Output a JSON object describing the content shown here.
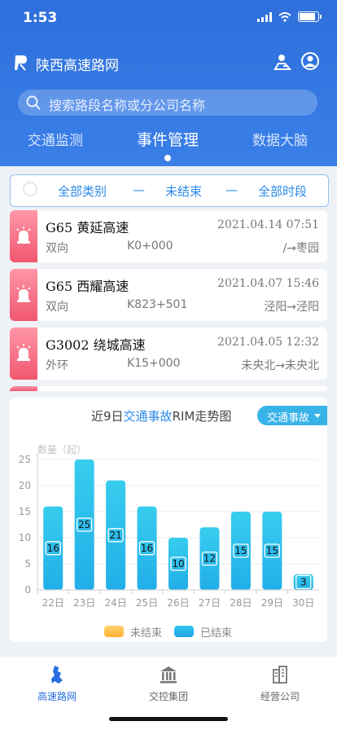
{
  "status_bar": {
    "time": "1:53"
  },
  "app": {
    "title": "陕西高速路网"
  },
  "search": {
    "placeholder": "搜索路段名称或分公司名称"
  },
  "tabs": [
    {
      "label": "交通监测",
      "active": false
    },
    {
      "label": "事件管理",
      "active": true
    },
    {
      "label": "数据大脑",
      "active": false
    }
  ],
  "filter": {
    "category": "全部类别",
    "sep": "—",
    "state": "未结束",
    "period": "全部时段"
  },
  "events": [
    {
      "road": "G65 黄延高速",
      "date": "2021.04.14 07:51",
      "direction": "双向",
      "position": "K0+000",
      "route": "/→枣园"
    },
    {
      "road": "G65 西耀高速",
      "date": "2021.04.07 15:46",
      "direction": "双向",
      "position": "K823+501",
      "route": "泾阳→泾阳"
    },
    {
      "road": "G3002 绕城高速",
      "date": "2021.04.05 12:32",
      "direction": "外环",
      "position": "K15+000",
      "route": "未央北→未央北"
    }
  ],
  "chart_header": {
    "prefix": "近9日",
    "highlight": "交通事故",
    "suffix": "RIM走势图",
    "dropdown": "交通事故"
  },
  "chart_data": {
    "type": "bar",
    "ylabel": "数量（起）",
    "ylim": [
      0,
      25
    ],
    "yticks": [
      0,
      5,
      10,
      15,
      20,
      25
    ],
    "categories": [
      "22日",
      "23日",
      "24日",
      "25日",
      "26日",
      "27日",
      "28日",
      "29日",
      "30日"
    ],
    "series": [
      {
        "name": "未结束",
        "values": [
          0,
          0,
          0,
          0,
          0,
          0,
          0,
          0,
          0
        ]
      },
      {
        "name": "已结束",
        "values": [
          16,
          25,
          21,
          16,
          10,
          12,
          15,
          15,
          3
        ]
      }
    ],
    "colors": {
      "open": "#ffc24a",
      "closed": "#22aee8"
    },
    "grid": "horizontal",
    "legend": "bottom"
  },
  "bottom_nav": [
    {
      "label": "高速路网",
      "active": true
    },
    {
      "label": "交控集团",
      "active": false
    },
    {
      "label": "经营公司",
      "active": false
    }
  ]
}
